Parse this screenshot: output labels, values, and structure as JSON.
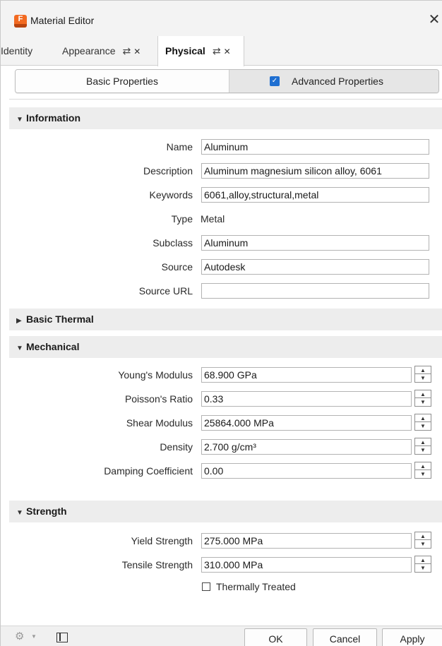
{
  "window": {
    "title": "Material Editor",
    "app_icon_letter": "F"
  },
  "tabs": [
    {
      "label": "Identity",
      "active": false
    },
    {
      "label": "Appearance",
      "active": false
    },
    {
      "label": "Physical",
      "active": true
    }
  ],
  "tab_glyphs": {
    "swap": "⇄",
    "close": "✕"
  },
  "property_mode": {
    "basic_label": "Basic Properties",
    "advanced_label": "Advanced Properties",
    "advanced_checked": true
  },
  "sections": {
    "information": {
      "title": "Information",
      "expanded": true,
      "fields": {
        "name": {
          "label": "Name",
          "value": "Aluminum"
        },
        "description": {
          "label": "Description",
          "value": "Aluminum magnesium silicon alloy, 6061"
        },
        "keywords": {
          "label": "Keywords",
          "value": "6061,alloy,structural,metal"
        },
        "type": {
          "label": "Type",
          "value": "Metal"
        },
        "subclass": {
          "label": "Subclass",
          "value": "Aluminum"
        },
        "source": {
          "label": "Source",
          "value": "Autodesk"
        },
        "source_url": {
          "label": "Source URL",
          "value": ""
        }
      }
    },
    "basic_thermal": {
      "title": "Basic Thermal",
      "expanded": false
    },
    "mechanical": {
      "title": "Mechanical",
      "expanded": true,
      "fields": {
        "youngs_modulus": {
          "label": "Young's Modulus",
          "value": "68.900 GPa"
        },
        "poissons_ratio": {
          "label": "Poisson's Ratio",
          "value": "0.33"
        },
        "shear_modulus": {
          "label": "Shear Modulus",
          "value": "25864.000 MPa"
        },
        "density": {
          "label": "Density",
          "value": "2.700 g/cm³"
        },
        "damping_coefficient": {
          "label": "Damping Coefficient",
          "value": "0.00"
        }
      }
    },
    "strength": {
      "title": "Strength",
      "expanded": true,
      "fields": {
        "yield_strength": {
          "label": "Yield Strength",
          "value": "275.000 MPa"
        },
        "tensile_strength": {
          "label": "Tensile Strength",
          "value": "310.000 MPa"
        }
      },
      "thermally_treated": {
        "label": "Thermally Treated",
        "checked": false
      }
    }
  },
  "footer": {
    "ok_label": "OK",
    "cancel_label": "Cancel",
    "apply_label": "Apply",
    "icons": [
      "material-browser-icon",
      "panel-toggle-icon"
    ]
  },
  "colors": {
    "app_icon": "#f26a21",
    "checkbox_accent": "#1f6fd1",
    "section_header_bg": "#ededed",
    "title_bar_bg": "#f3f3f3"
  }
}
